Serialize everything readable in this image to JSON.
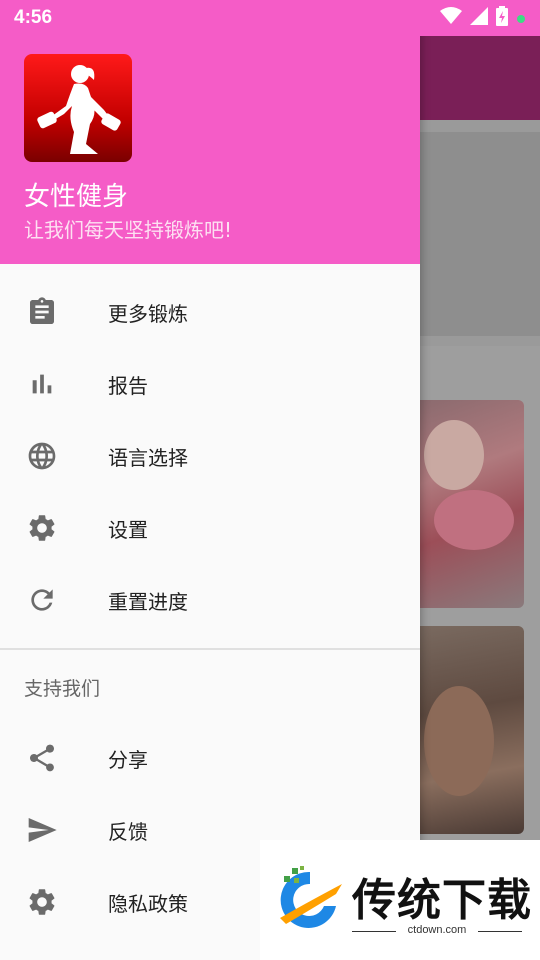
{
  "status_bar": {
    "time": "4:56"
  },
  "drawer": {
    "header": {
      "app_name": "女性健身",
      "slogan": "让我们每天坚持锻炼吧!"
    },
    "menu": [
      {
        "label": "更多锻炼",
        "icon": "clipboard-icon"
      },
      {
        "label": "报告",
        "icon": "bar-chart-icon"
      },
      {
        "label": "语言选择",
        "icon": "globe-icon"
      },
      {
        "label": "设置",
        "icon": "gear-icon"
      },
      {
        "label": "重置进度",
        "icon": "refresh-icon"
      }
    ],
    "support_section": {
      "title": "支持我们",
      "items": [
        {
          "label": "分享",
          "icon": "share-icon"
        },
        {
          "label": "反馈",
          "icon": "send-icon"
        },
        {
          "label": "隐私政策",
          "icon": "gear-icon"
        }
      ]
    }
  },
  "watermark": {
    "text": "传统下载",
    "url": "ctdown.com"
  },
  "colors": {
    "header_pink": "#f55cc7",
    "icon_gray": "#6b6b6b"
  }
}
